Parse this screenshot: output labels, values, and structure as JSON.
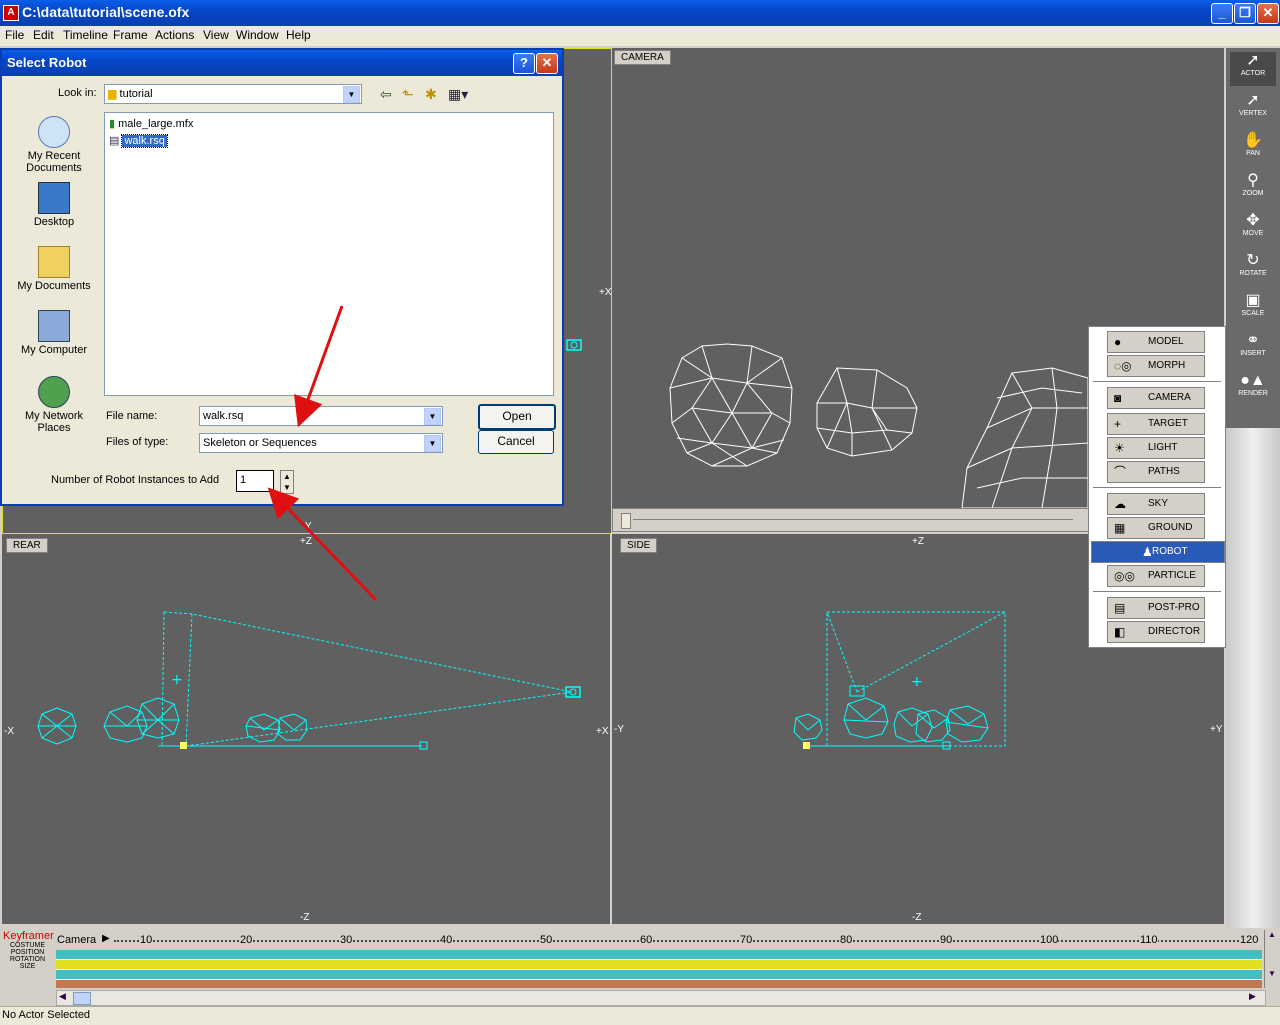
{
  "window": {
    "title": "C:\\data\\tutorial\\scene.ofx",
    "minimize": "_",
    "maximize": "❐",
    "close": "✕"
  },
  "menu": [
    "File",
    "Edit",
    "Timeline",
    "Frame",
    "Actions",
    "View",
    "Window",
    "Help"
  ],
  "viewports": {
    "camera": {
      "label": "CAMERA"
    },
    "rear": {
      "label": "REAR",
      "axes": {
        "top": "+Z",
        "bottom": "-Z",
        "left": "-X",
        "right": "+X",
        "topmid": "Y"
      }
    },
    "side": {
      "label": "SIDE",
      "axes": {
        "top": "+Z",
        "bottom": "-Z",
        "left": "-Y",
        "right": "+Y"
      }
    },
    "topleft": {
      "axes": {
        "right": "+X"
      }
    }
  },
  "dialog": {
    "title": "Select Robot",
    "help": "?",
    "close": "✕",
    "look_in_label": "Look in:",
    "look_in_value": "tutorial",
    "places": [
      "My Recent Documents",
      "Desktop",
      "My Documents",
      "My Computer",
      "My Network Places"
    ],
    "files": [
      "male_large.mfx",
      "walk.rsq"
    ],
    "file_name_label": "File name:",
    "file_name_value": "walk.rsq",
    "file_type_label": "Files of type:",
    "file_type_value": "Skeleton or Sequences",
    "open_button": "Open",
    "cancel_button": "Cancel",
    "instances_label": "Number of Robot Instances to Add",
    "instances_value": "1"
  },
  "toolbar": [
    {
      "label": "ACTOR",
      "key": "O"
    },
    {
      "label": "VERTEX",
      "key": "V"
    },
    {
      "label": "PAN",
      "key": "P"
    },
    {
      "label": "ZOOM",
      "key": "Z"
    },
    {
      "label": "MOVE",
      "key": "M"
    },
    {
      "label": "ROTATE",
      "key": "R"
    },
    {
      "label": "SCALE",
      "key": "S"
    },
    {
      "label": "INSERT",
      "key": ""
    },
    {
      "label": "RENDER",
      "key": ""
    }
  ],
  "insert_menu": {
    "items": [
      "MODEL",
      "MORPH",
      "CAMERA",
      "TARGET",
      "LIGHT",
      "PATHS",
      "SKY",
      "GROUND",
      "ROBOT",
      "PARTICLE",
      "POST-PRO",
      "DIRECTOR"
    ],
    "selected": "ROBOT"
  },
  "timeline": {
    "title": "Keyframer",
    "tracks": [
      "COSTUME",
      "POSITION",
      "ROTATION",
      "SIZE"
    ],
    "actor": "Camera",
    "ticks": [
      "10",
      "20",
      "30",
      "40",
      "50",
      "60",
      "70",
      "80",
      "90",
      "100",
      "110",
      "120"
    ]
  },
  "status": "No Actor Selected"
}
